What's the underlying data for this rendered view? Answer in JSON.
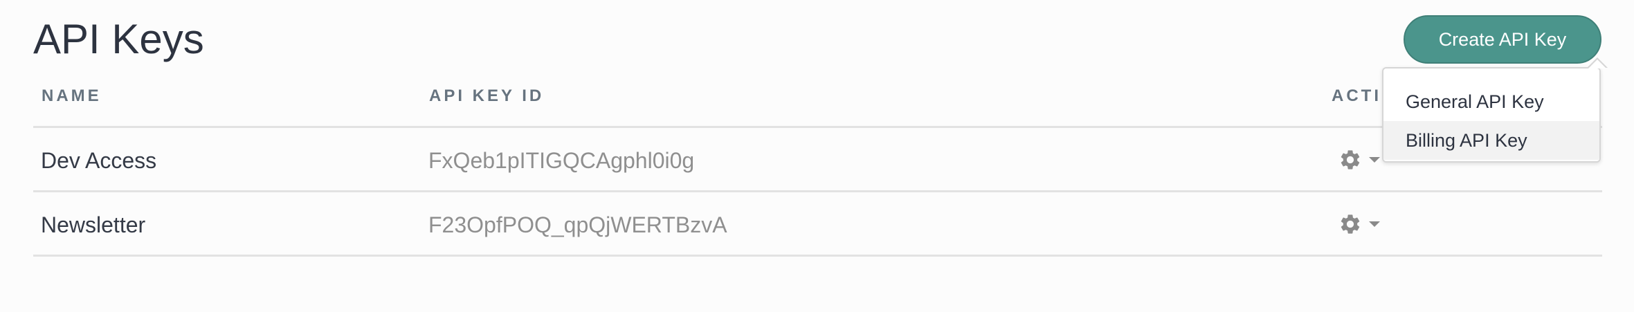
{
  "page": {
    "title": "API Keys"
  },
  "header": {
    "create_button_label": "Create API Key"
  },
  "table": {
    "columns": {
      "name": "NAME",
      "key_id": "API KEY ID",
      "actions": "ACTI"
    },
    "rows": [
      {
        "name": "Dev Access",
        "key_id": "FxQeb1pITIGQCAgphl0i0g"
      },
      {
        "name": "Newsletter",
        "key_id": "F23OpfPOQ_qpQjWERTBzvA"
      }
    ]
  },
  "dropdown": {
    "items": [
      {
        "label": "General API Key"
      },
      {
        "label": "Billing API Key"
      }
    ]
  },
  "icons": {
    "row_action": "gear-icon",
    "row_action_caret": "caret-down-icon"
  },
  "colors": {
    "accent": "#4b958c",
    "title_text": "#2d3340",
    "header_text": "#66737f",
    "key_text": "#8f8f8f",
    "divider": "#e2e2e2"
  }
}
